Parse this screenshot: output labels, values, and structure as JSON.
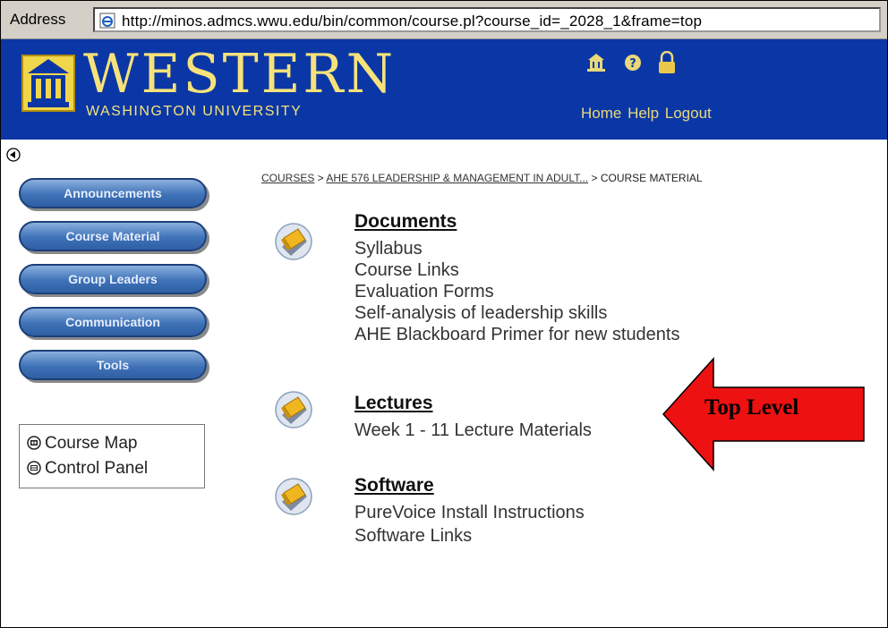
{
  "address_bar": {
    "label": "Address",
    "url": "http://minos.admcs.wwu.edu/bin/common/course.pl?course_id=_2028_1&frame=top"
  },
  "header": {
    "brand_name": "WESTERN",
    "brand_sub": "WASHINGTON UNIVERSITY",
    "links_text": "Home Help Logout",
    "colors": {
      "banner": "#0b37a6",
      "brand": "#f6e27a"
    }
  },
  "breadcrumb": {
    "courses": "COURSES",
    "sep1": " > ",
    "course": "AHE 576 LEADERSHIP & MANAGEMENT IN ADULT...",
    "sep2": " > ",
    "current": "COURSE MATERIAL"
  },
  "sidebar": {
    "buttons": [
      "Announcements",
      "Course Material",
      "Group Leaders",
      "Communication",
      "Tools"
    ],
    "tools": [
      "Course Map",
      "Control Panel"
    ]
  },
  "content": {
    "folders": [
      {
        "title": "Documents",
        "items": [
          "Syllabus",
          "Course Links",
          "Evaluation Forms",
          "Self-analysis of leadership skills",
          "AHE Blackboard Primer for new students"
        ]
      },
      {
        "title": "Lectures",
        "items": [
          "Week 1 - 11 Lecture Materials"
        ]
      },
      {
        "title": "Software",
        "items": [
          "PureVoice Install Instructions",
          "Software Links"
        ]
      }
    ]
  },
  "callout": {
    "label": "Top Level",
    "color": "#ee1111"
  }
}
